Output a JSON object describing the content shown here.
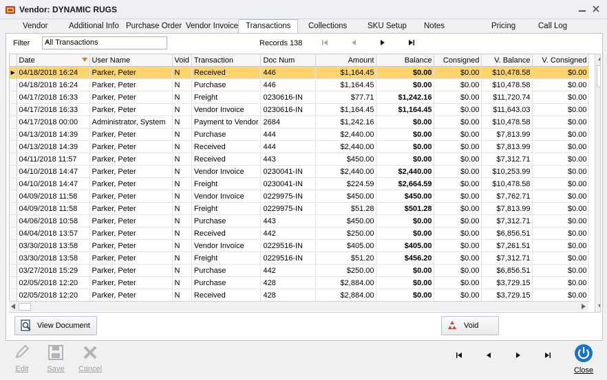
{
  "window": {
    "title": "Vendor: DYNAMIC RUGS"
  },
  "tabs": [
    "Vendor",
    "Additional Info",
    "Purchase Order",
    "Vendor Invoice",
    "Transactions",
    "Collections",
    "SKU Setup",
    "Notes",
    "Pricing",
    "Call Log"
  ],
  "active_tab": "Transactions",
  "filter": {
    "label": "Filter",
    "value": "All Transactions"
  },
  "records": "Records 138",
  "columns": [
    "Date",
    "User Name",
    "Void",
    "Transaction",
    "Doc Num",
    "Amount",
    "Balance",
    "Consigned",
    "V. Balance",
    "V. Consigned"
  ],
  "rows": [
    [
      "04/18/2018 16:24",
      "Parker, Peter",
      "N",
      "Received",
      "446",
      "$1,164.45",
      "$0.00",
      "$0.00",
      "$10,478.58",
      "$0.00"
    ],
    [
      "04/18/2018 16:24",
      "Parker, Peter",
      "N",
      "Purchase",
      "446",
      "$1,164.45",
      "$0.00",
      "$0.00",
      "$10,478.58",
      "$0.00"
    ],
    [
      "04/17/2018 16:33",
      "Parker, Peter",
      "N",
      "Freight",
      "0230616-IN",
      "$77.71",
      "$1,242.16",
      "$0.00",
      "$11,720.74",
      "$0.00"
    ],
    [
      "04/17/2018 16:33",
      "Parker, Peter",
      "N",
      "Vendor Invoice",
      "0230616-IN",
      "$1,164.45",
      "$1,164.45",
      "$0.00",
      "$11,643.03",
      "$0.00"
    ],
    [
      "04/17/2018 00:00",
      "Administrator, System",
      "N",
      "Payment to Vendor",
      "2684",
      "$1,242.16",
      "$0.00",
      "$0.00",
      "$10,478.58",
      "$0.00"
    ],
    [
      "04/13/2018 14:39",
      "Parker, Peter",
      "N",
      "Purchase",
      "444",
      "$2,440.00",
      "$0.00",
      "$0.00",
      "$7,813.99",
      "$0.00"
    ],
    [
      "04/13/2018 14:39",
      "Parker, Peter",
      "N",
      "Received",
      "444",
      "$2,440.00",
      "$0.00",
      "$0.00",
      "$7,813.99",
      "$0.00"
    ],
    [
      "04/11/2018 11:57",
      "Parker, Peter",
      "N",
      "Received",
      "443",
      "$450.00",
      "$0.00",
      "$0.00",
      "$7,312.71",
      "$0.00"
    ],
    [
      "04/10/2018 14:47",
      "Parker, Peter",
      "N",
      "Vendor Invoice",
      "0230041-IN",
      "$2,440.00",
      "$2,440.00",
      "$0.00",
      "$10,253.99",
      "$0.00"
    ],
    [
      "04/10/2018 14:47",
      "Parker, Peter",
      "N",
      "Freight",
      "0230041-IN",
      "$224.59",
      "$2,664.59",
      "$0.00",
      "$10,478.58",
      "$0.00"
    ],
    [
      "04/09/2018 11:58",
      "Parker, Peter",
      "N",
      "Vendor Invoice",
      "0229975-IN",
      "$450.00",
      "$450.00",
      "$0.00",
      "$7,762.71",
      "$0.00"
    ],
    [
      "04/09/2018 11:58",
      "Parker, Peter",
      "N",
      "Freight",
      "0229975-IN",
      "$51.28",
      "$501.28",
      "$0.00",
      "$7,813.99",
      "$0.00"
    ],
    [
      "04/06/2018 10:58",
      "Parker, Peter",
      "N",
      "Purchase",
      "443",
      "$450.00",
      "$0.00",
      "$0.00",
      "$7,312.71",
      "$0.00"
    ],
    [
      "04/04/2018 13:57",
      "Parker, Peter",
      "N",
      "Received",
      "442",
      "$250.00",
      "$0.00",
      "$0.00",
      "$6,856.51",
      "$0.00"
    ],
    [
      "03/30/2018 13:58",
      "Parker, Peter",
      "N",
      "Vendor Invoice",
      "0229516-IN",
      "$405.00",
      "$405.00",
      "$0.00",
      "$7,261.51",
      "$0.00"
    ],
    [
      "03/30/2018 13:58",
      "Parker, Peter",
      "N",
      "Freight",
      "0229516-IN",
      "$51.20",
      "$456.20",
      "$0.00",
      "$7,312.71",
      "$0.00"
    ],
    [
      "03/27/2018 15:29",
      "Parker, Peter",
      "N",
      "Purchase",
      "442",
      "$250.00",
      "$0.00",
      "$0.00",
      "$6,856.51",
      "$0.00"
    ],
    [
      "02/05/2018 12:20",
      "Parker, Peter",
      "N",
      "Purchase",
      "428",
      "$2,884.00",
      "$0.00",
      "$0.00",
      "$3,729.15",
      "$0.00"
    ],
    [
      "02/05/2018 12:20",
      "Parker, Peter",
      "N",
      "Received",
      "428",
      "$2,884.00",
      "$0.00",
      "$0.00",
      "$3,729.15",
      "$0.00"
    ]
  ],
  "buttons": {
    "view_document": "View Document",
    "void": "Void"
  },
  "footer": {
    "edit": "Edit",
    "save": "Save",
    "cancel": "Cancel",
    "close": "Close"
  },
  "colors": {
    "selected_row": "#ffd56b",
    "sort_arrow": "#e07828",
    "close_icon": "#1a73c8"
  }
}
